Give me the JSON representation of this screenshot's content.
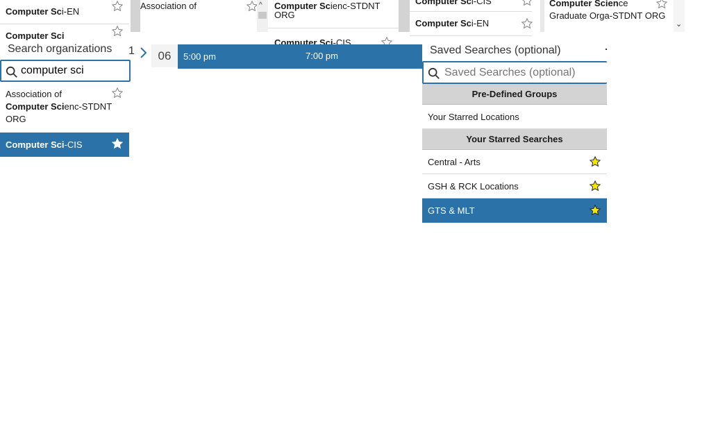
{
  "colors": {
    "accent": "#2a72a8",
    "header_gray": "#d3d3d3",
    "star_fill": "#f5e600"
  },
  "bg_fragments": {
    "f1_line1_bold": "Computer Sc",
    "f1_line1_rest": "i-EN",
    "f1_line2_bold": "Computer Sci",
    "f2_text": "Associ",
    "f2_text_rest": "ation of",
    "f3_bold": "Compu",
    "f3_bold2": "ter Sc",
    "f3_rest": "ienc-STDNT",
    "f3_line2": "ORG",
    "f3_line3_bold": "Compu",
    "f3_line3_bold2": "ter Sci",
    "f3_line3_rest": "-CIS",
    "f4_line1_bold": "Computer Sc",
    "f4_line1_rest": "i-CIS",
    "f4_line2_bold": "Computer Sc",
    "f4_line2_rest": "i-EN",
    "f5_line1_bold": "Computer Scien",
    "f5_line1_rest": "ce",
    "f5_line2": "Graduate Orga-ST",
    "f5_line2_rest": "DNT ORG"
  },
  "org_search": {
    "label": "Search organizations",
    "value": "computer sci",
    "results": [
      {
        "line1": "Association of",
        "bold": "Computer Sci",
        "rest": "enc-STDNT",
        "line3": "ORG",
        "starred": false
      },
      {
        "bold": "Computer Sci",
        "rest": "-CIS",
        "starred": true,
        "selected": true
      }
    ]
  },
  "date_nav": {
    "partial_digit": "1",
    "day": "06"
  },
  "times": {
    "t1": "5:00 pm",
    "t2": "7:00 pm"
  },
  "saved_searches": {
    "label": "Saved Searches (optional)",
    "placeholder": "Saved Searches (optional)",
    "groups_header": "Pre-Defined Groups",
    "starred_locations": "Your Starred Locations",
    "starred_header": "Your Starred Searches",
    "items": [
      {
        "label": "Central - Arts",
        "selected": false
      },
      {
        "label": "GSH & RCK Locations",
        "selected": false
      },
      {
        "label": "GTS & MLT",
        "selected": true
      }
    ]
  }
}
